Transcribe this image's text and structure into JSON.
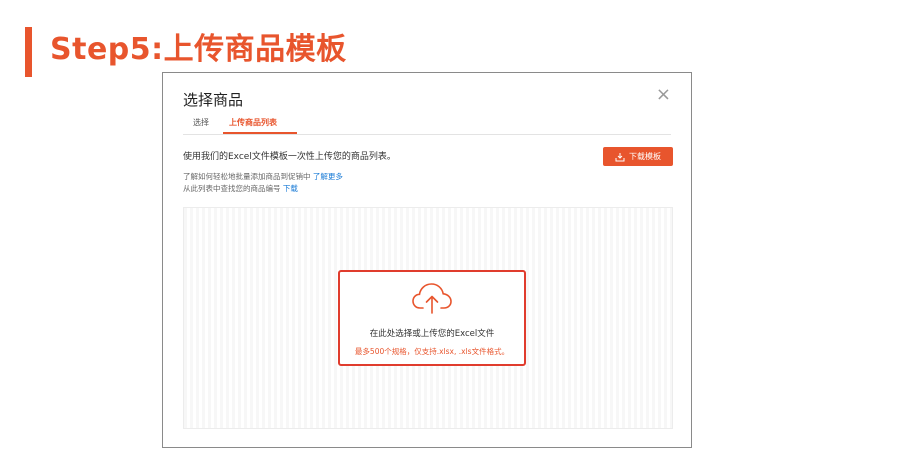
{
  "page": {
    "heading": "Step5:上传商品模板",
    "accent_color": "#e8552d"
  },
  "dialog": {
    "title": "选择商品",
    "close_glyph": "×",
    "tabs": [
      {
        "label": "选择",
        "active": false
      },
      {
        "label": "上传商品列表",
        "active": true
      }
    ],
    "description": "使用我们的Excel文件模板一次性上传您的商品列表。",
    "download_button": {
      "label": "下载模板",
      "icon": "download-icon"
    },
    "help": {
      "line1_text": "了解如何轻松地批量添加商品到促销中",
      "line1_link": "了解更多",
      "line2_text": "从此列表中查找您的商品编号",
      "line2_link": "下载"
    },
    "dropzone": {
      "icon": "upload-cloud-icon",
      "main_text": "在此处选择或上传您的Excel文件",
      "sub_text": "最多500个规格，仅支持.xlsx, .xls文件格式。"
    }
  }
}
